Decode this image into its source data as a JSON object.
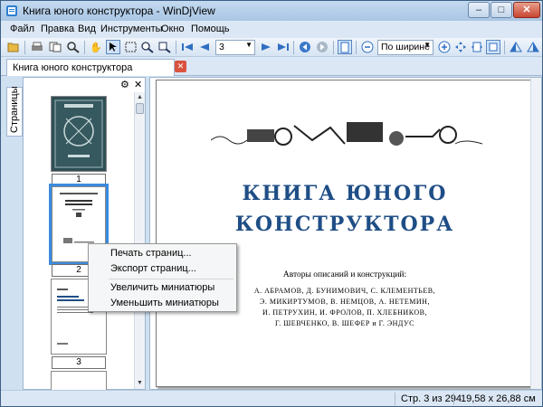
{
  "window": {
    "title": "Книга юного конструктора - WinDjView",
    "buttons": {
      "minimize": "–",
      "maximize": "□",
      "close": "✕"
    }
  },
  "menu": [
    "Файл",
    "Правка",
    "Вид",
    "Инструменты",
    "Окно",
    "Помощь"
  ],
  "toolbar": {
    "page_value": "3",
    "zoom_value": "По ширине",
    "icons": [
      "open-icon",
      "print-icon",
      "find-icon",
      "hand-tool-icon",
      "select-cursor-icon",
      "zoom-rect-icon",
      "zoom-in-icon",
      "zoom-out-icon",
      "first-page-icon",
      "prev-page-icon",
      "next-page-icon",
      "last-page-icon",
      "back-icon",
      "forward-icon",
      "single-page-icon",
      "zoom-minus-icon",
      "zoom-plus-icon",
      "fit-icon",
      "rotate-left-icon",
      "rotate-right-icon"
    ]
  },
  "tab": {
    "label": "Книга юного конструктора",
    "close": "✕"
  },
  "sidebar": {
    "tab_label": "Страницы",
    "gear": "⚙",
    "close": "✕"
  },
  "thumbnails": [
    {
      "number": "1"
    },
    {
      "number": "2",
      "selected": true
    },
    {
      "number": "3"
    }
  ],
  "page": {
    "title_line1": "КНИГА ЮНОГО",
    "title_line2": "КОНСТРУКТОРА",
    "authors_heading": "Авторы описаний и конструкций:",
    "authors_lines": [
      "А. АБРАМОВ, Д. БУНИМОВИЧ, С. КЛЕМЕНТЬЕВ,",
      "Э. МИКИРТУМОВ, В. НЕМЦОВ, А. НЕТЕМИН,",
      "И. ПЕТРУХИН, И. ФРОЛОВ, П. ХЛЕБНИКОВ,",
      "Г. ШЕВЧЕНКО, В. ШЕФЕР и Г. ЭНДУС"
    ]
  },
  "context_menu": {
    "items": [
      "Печать страниц...",
      "Экспорт страниц...",
      "Увеличить миниатюры",
      "Уменьшить миниатюры"
    ]
  },
  "status": {
    "page_info": "Стр. 3 из 294",
    "page_size": "19,58 x 26,88 см"
  }
}
